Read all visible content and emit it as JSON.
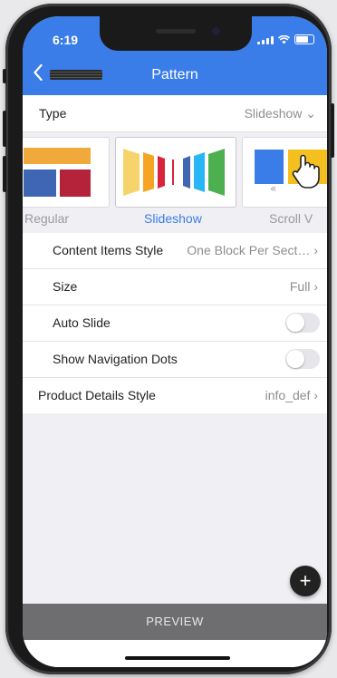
{
  "status": {
    "time": "6:19"
  },
  "header": {
    "back_icon": "chevron-left-icon",
    "title": "Pattern"
  },
  "type_row": {
    "label": "Type",
    "value": "Slideshow ⌄"
  },
  "patterns": [
    {
      "label": "Regular",
      "active": false
    },
    {
      "label": "Slideshow",
      "active": true
    },
    {
      "label": "Scroll V",
      "active": false
    }
  ],
  "settings": {
    "content_items_style": {
      "label": "Content Items Style",
      "value": "One Block Per Sect… ›"
    },
    "size": {
      "label": "Size",
      "value": "Full ›"
    },
    "auto_slide": {
      "label": "Auto Slide",
      "on": false
    },
    "show_navigation_dots": {
      "label": "Show Navigation Dots",
      "on": false
    },
    "product_details_style": {
      "label": "Product Details Style",
      "value": "info_def ›"
    }
  },
  "fab": {
    "icon": "plus-icon",
    "label": "+"
  },
  "preview": {
    "label": "PREVIEW"
  },
  "colors": {
    "accent": "#3a7de8",
    "preview_bar": "#6e6e70"
  }
}
